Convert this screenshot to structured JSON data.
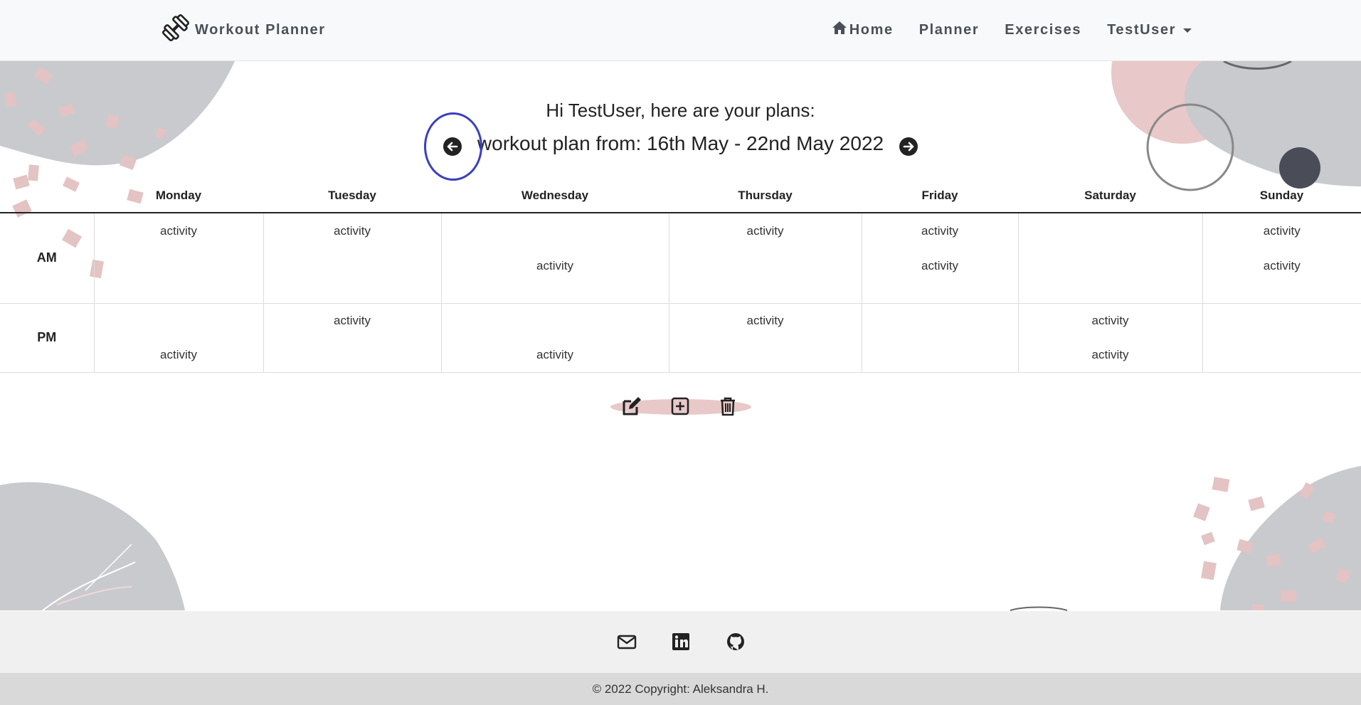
{
  "navbar": {
    "brand": "Workout Planner",
    "brand_icon": "dumbbell-icon",
    "links": {
      "home": "Home",
      "planner": "Planner",
      "exercises": "Exercises",
      "user": "TestUser"
    }
  },
  "greeting": "Hi TestUser, here are your plans:",
  "plan_title": "workout plan from: 16th May - 22nd May 2022",
  "table": {
    "headers": [
      "Monday",
      "Tuesday",
      "Wednesday",
      "Thursday",
      "Friday",
      "Saturday",
      "Sunday"
    ],
    "rows": [
      {
        "label": "AM",
        "cells": [
          [
            "activity",
            ""
          ],
          [
            "activity",
            ""
          ],
          [
            "",
            "activity"
          ],
          [
            "activity",
            ""
          ],
          [
            "activity",
            "activity"
          ],
          [
            "",
            ""
          ],
          [
            "activity",
            "activity"
          ]
        ]
      },
      {
        "label": "PM",
        "cells": [
          [
            "",
            "activity"
          ],
          [
            "activity",
            ""
          ],
          [
            "",
            "activity"
          ],
          [
            "activity",
            ""
          ],
          [
            "",
            ""
          ],
          [
            "activity",
            "activity"
          ],
          [
            "",
            ""
          ]
        ]
      }
    ]
  },
  "actions": [
    "edit-icon",
    "add-icon",
    "delete-icon"
  ],
  "footer": {
    "social": [
      "mail-icon",
      "linkedin-icon",
      "github-icon"
    ],
    "copyright": "© 2022 Copyright: Aleksandra H."
  },
  "colors": {
    "navbar_bg": "#f8f9fa",
    "nav_text": "#495057",
    "highlight_ring": "#3a3fbf",
    "blob_gray": "#c9cace",
    "blob_pink": "#e8c8c8",
    "footer_top": "#f0f0f0",
    "footer_bottom": "#d9d9d9"
  }
}
